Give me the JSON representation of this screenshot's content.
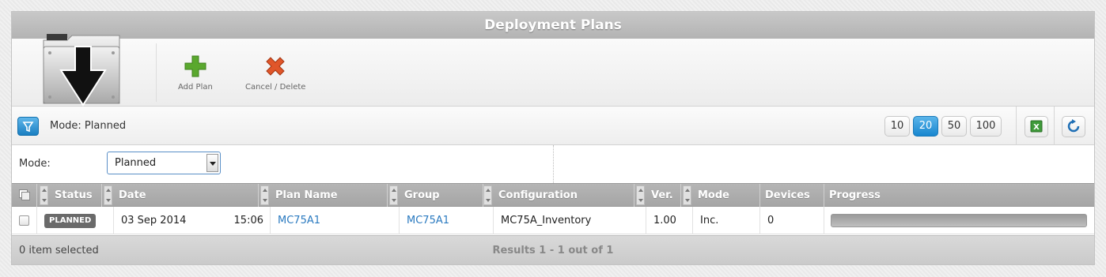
{
  "window": {
    "title": "Deployment Plans"
  },
  "toolbar": {
    "logo_icon": "download-folder-icon",
    "add_plan_label": "Add Plan",
    "add_plan_icon": "green-plus-icon",
    "cancel_delete_label": "Cancel / Delete",
    "cancel_delete_icon": "red-x-icon"
  },
  "filterbar": {
    "filter_icon": "filter-funnel-icon",
    "mode_summary": "Mode: Planned",
    "page_sizes": [
      "10",
      "20",
      "50",
      "100"
    ],
    "active_page_size": "20",
    "export_icon": "excel-export-icon",
    "refresh_icon": "refresh-icon"
  },
  "mode_filter": {
    "label": "Mode:",
    "selected": "Planned"
  },
  "grid": {
    "columns": [
      "Status",
      "Date",
      "Plan Name",
      "Group",
      "Configuration",
      "Ver.",
      "Mode",
      "Devices",
      "Progress"
    ],
    "rows": [
      {
        "status": "PLANNED",
        "date": "03 Sep 2014",
        "time": "15:06",
        "plan_name": "MC75A1",
        "group": "MC75A1",
        "configuration": "MC75A_Inventory",
        "version": "1.00",
        "mode": "Inc.",
        "devices": "0",
        "progress": 0
      }
    ]
  },
  "footer": {
    "selection": "0 item selected",
    "results": "Results 1 - 1 out of 1"
  },
  "colors": {
    "accent": "#1886cf",
    "header": "#b3b3b3",
    "link": "#2a7ac0"
  }
}
